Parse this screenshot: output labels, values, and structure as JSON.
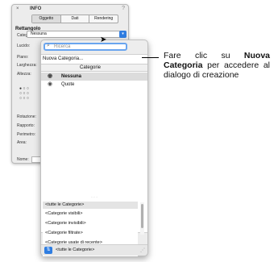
{
  "palette": {
    "title": "INFO",
    "close_glyph": "×",
    "help_glyph": "?",
    "tabs": [
      "Oggetto",
      "Dati",
      "Rendering"
    ],
    "heading": "Rettangolo",
    "labels": {
      "categoria": "Categoria:",
      "lucido": "Lucido:",
      "piano": "Piano:",
      "larghezza": "Larghezza:",
      "altezza": "Altezza:",
      "rotazione": "Rotazione:",
      "rapporto": "Rapporto:",
      "perimetro": "Perimetro:",
      "area": "Area:",
      "nome": "Nome:"
    },
    "categoria_value": "Nessuna"
  },
  "popup": {
    "search_placeholder": "Ricerca",
    "new_category": "Nuova Categoria...",
    "column_header": "Categorie",
    "categories": [
      {
        "label": "Nessuna",
        "selected": true
      },
      {
        "label": "Quote",
        "selected": false
      }
    ],
    "filters": [
      "<tutte le Categorie>",
      "<Categorie visibili>",
      "<Categorie invisibili>",
      "<Categorie filtrate>",
      "<Categorie usate di recente>"
    ],
    "bottom_label": "<tutte le Categorie>"
  },
  "annotation": {
    "part1": "Fare clic su ",
    "bold": "Nuova Categoria",
    "part2": " per accedere al dialogo di creazione"
  },
  "colors": {
    "accent": "#2f7de1",
    "search_focus": "#6aa5ef"
  },
  "icons": [
    "search-icon",
    "eye-icon",
    "close-icon",
    "help-icon",
    "chevron-down-icon",
    "resize-grip-icon"
  ]
}
